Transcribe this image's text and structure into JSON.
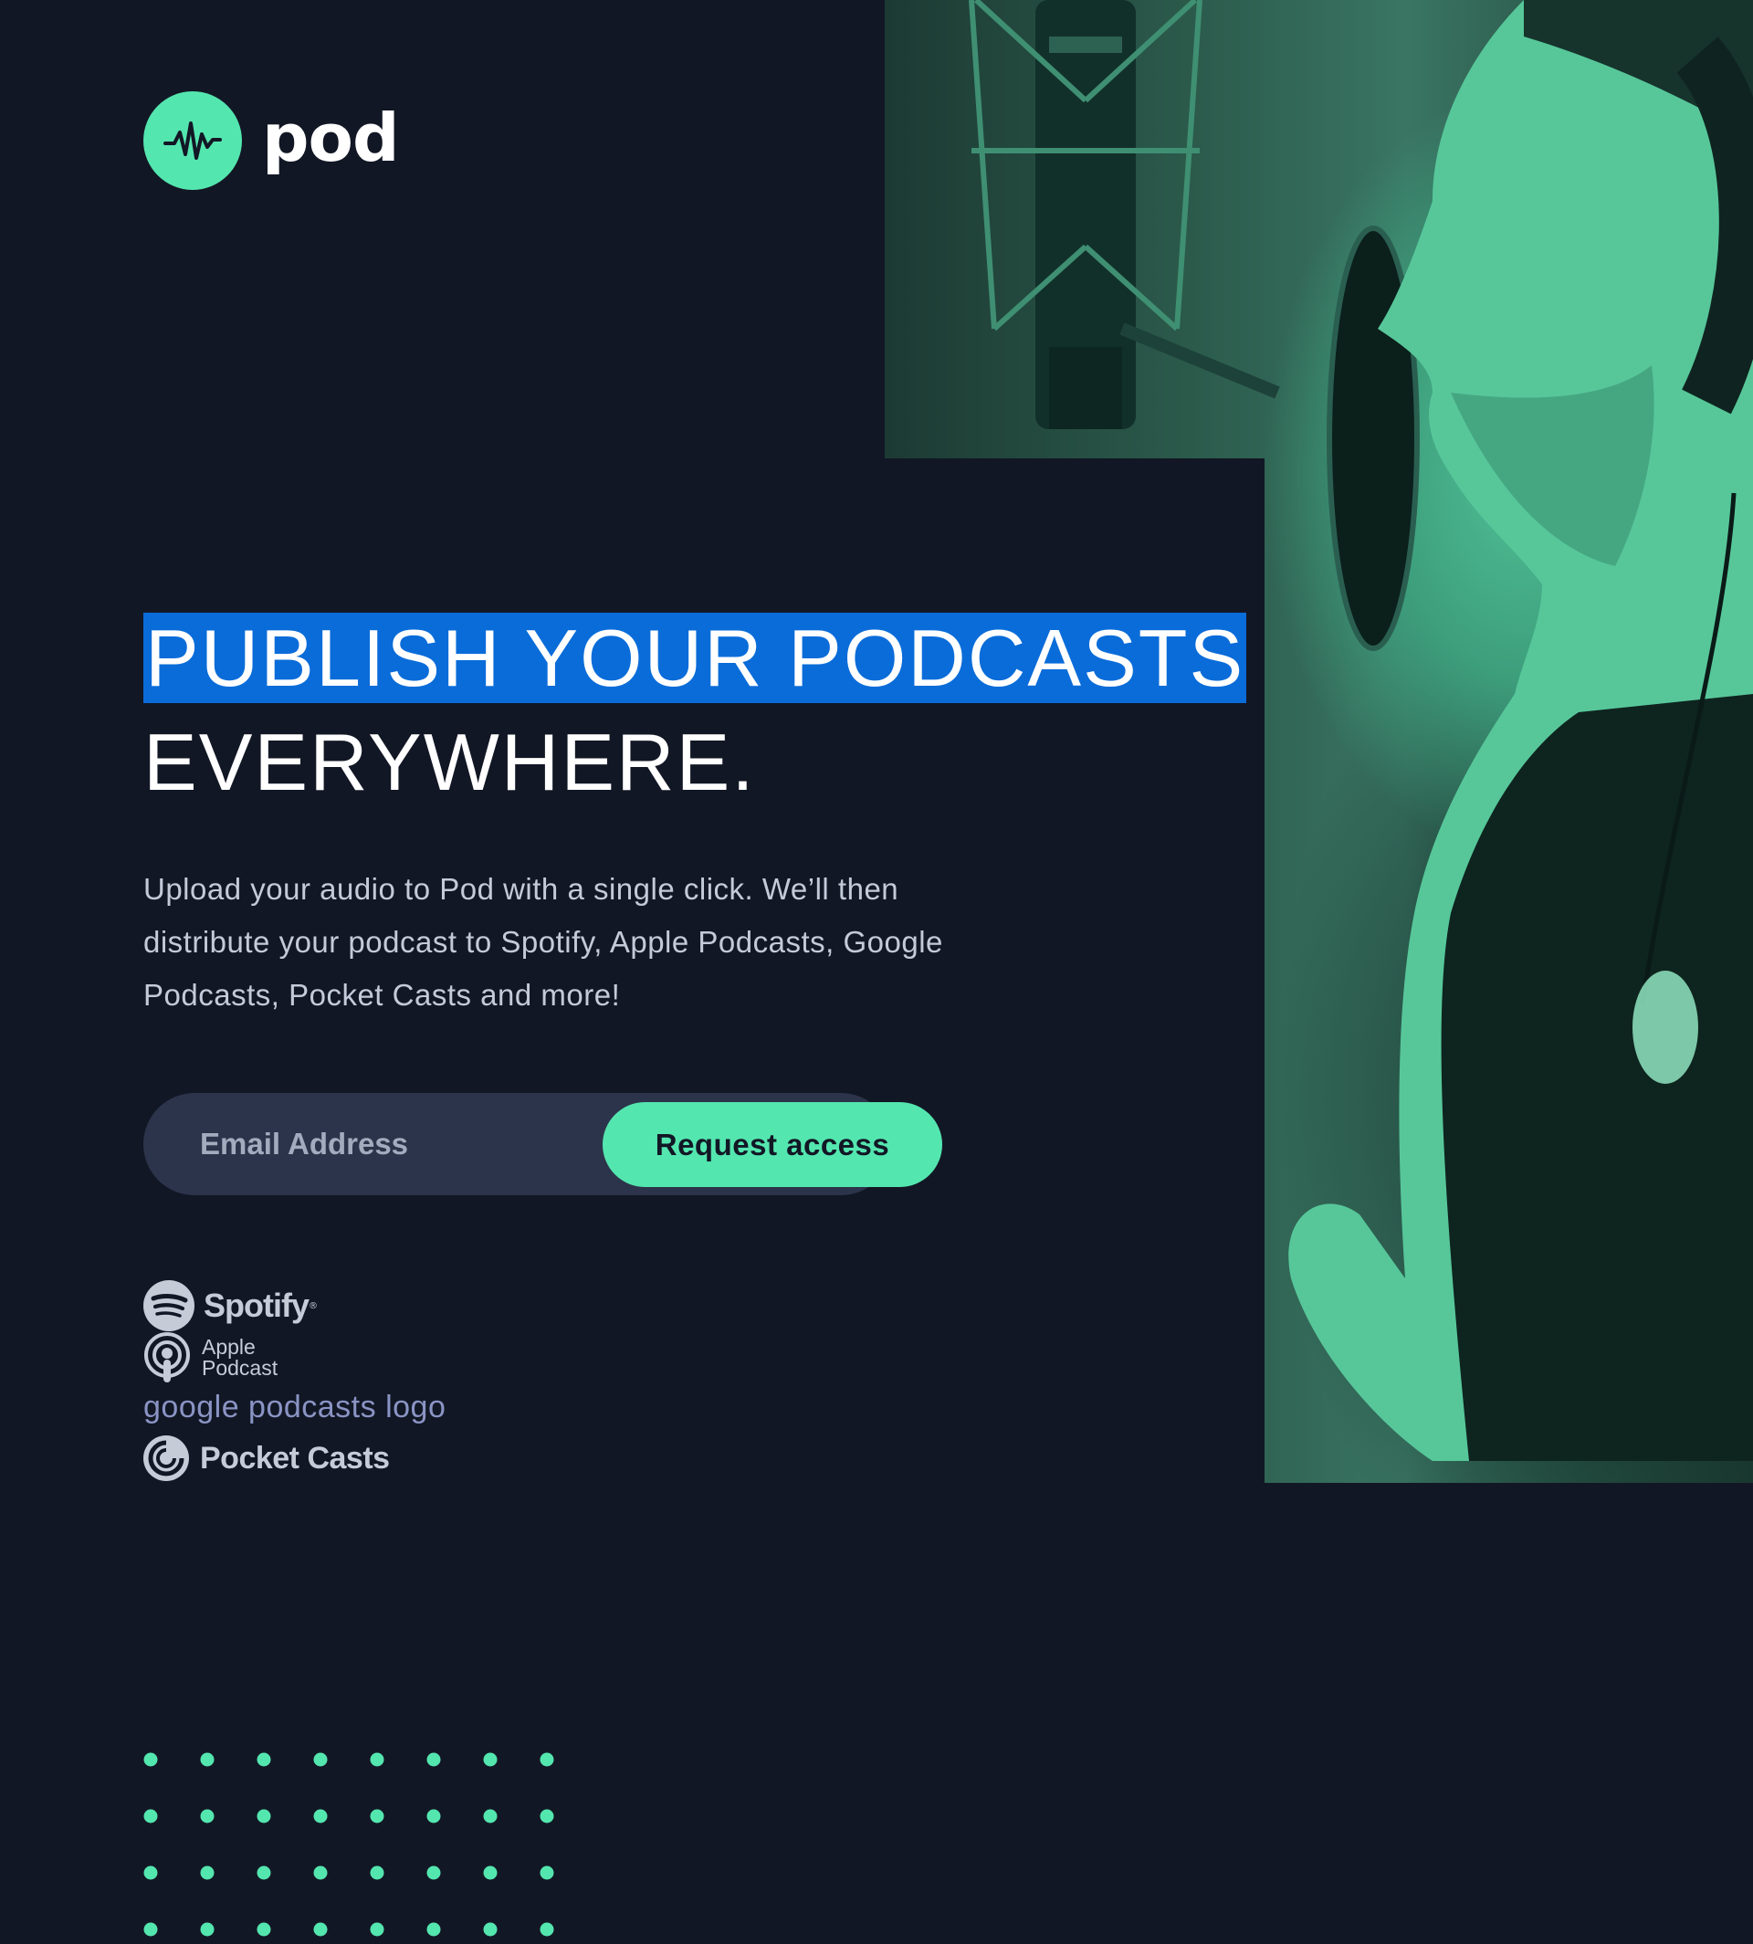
{
  "brand": {
    "name": "pod",
    "accent": "#54e6af",
    "background": "#121725"
  },
  "hero": {
    "headline_line1": "PUBLISH YOUR PODCASTS",
    "headline_line2": "EVERYWHERE.",
    "description": "Upload your audio to Pod with a single click. We’ll then distribute your podcast to Spotify, Apple Podcasts, Google Podcasts, Pocket Casts and more!",
    "image_subject": "man singing into studio microphone with headphones (green duotone)"
  },
  "form": {
    "email_placeholder": "Email Address",
    "email_value": "",
    "button_label": "Request access"
  },
  "platforms": {
    "spotify": {
      "name": "Spotify",
      "icon": "spotify-icon"
    },
    "apple": {
      "line1": "Apple",
      "line2": "Podcast",
      "icon": "apple-podcast-icon"
    },
    "google": {
      "alt_text": "google podcasts logo"
    },
    "pocket": {
      "name": "Pocket Casts",
      "icon": "pocket-casts-icon"
    }
  },
  "decor": {
    "dot_pattern": "8x4 green dot grid"
  }
}
